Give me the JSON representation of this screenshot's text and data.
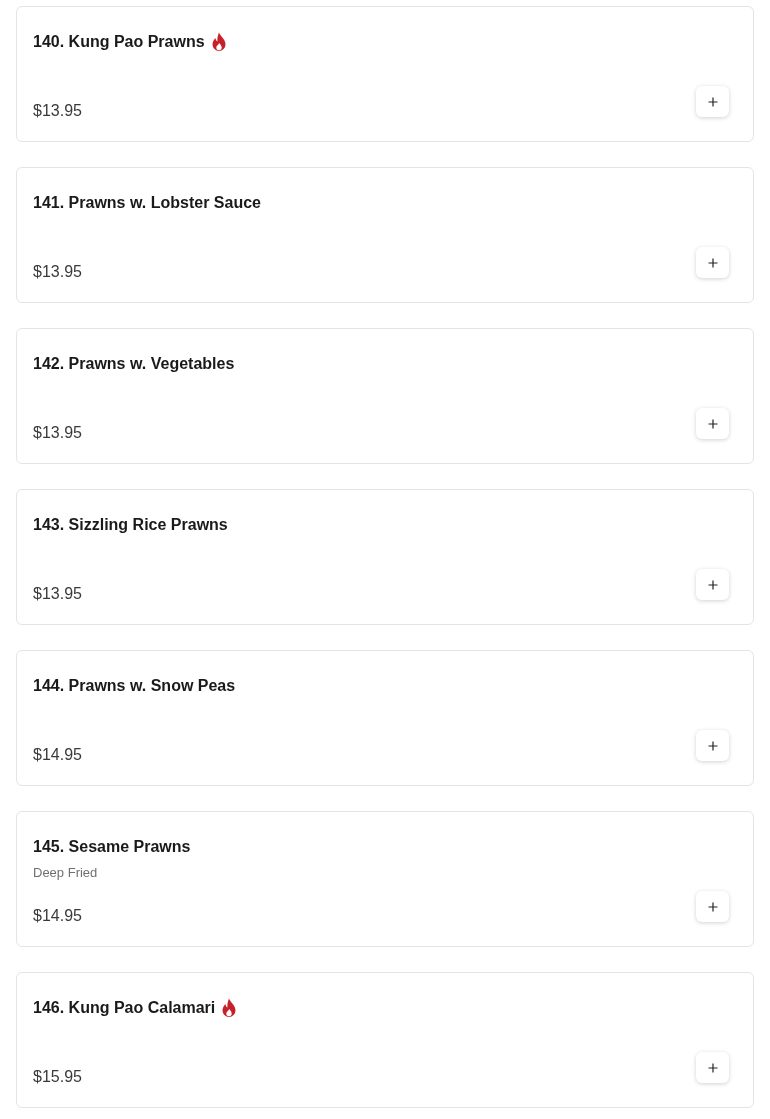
{
  "items": [
    {
      "title": "140. Kung Pao Prawns",
      "spicy": true,
      "price": "$13.95"
    },
    {
      "title": "141. Prawns w. Lobster Sauce",
      "spicy": false,
      "price": "$13.95"
    },
    {
      "title": "142. Prawns w. Vegetables",
      "spicy": false,
      "price": "$13.95"
    },
    {
      "title": "143. Sizzling Rice Prawns",
      "spicy": false,
      "price": "$13.95"
    },
    {
      "title": "144. Prawns w. Snow Peas",
      "spicy": false,
      "price": "$14.95"
    },
    {
      "title": "145. Sesame Prawns",
      "description": "Deep Fried",
      "spicy": false,
      "price": "$14.95"
    },
    {
      "title": "146. Kung Pao Calamari",
      "spicy": true,
      "price": "$15.95"
    }
  ]
}
